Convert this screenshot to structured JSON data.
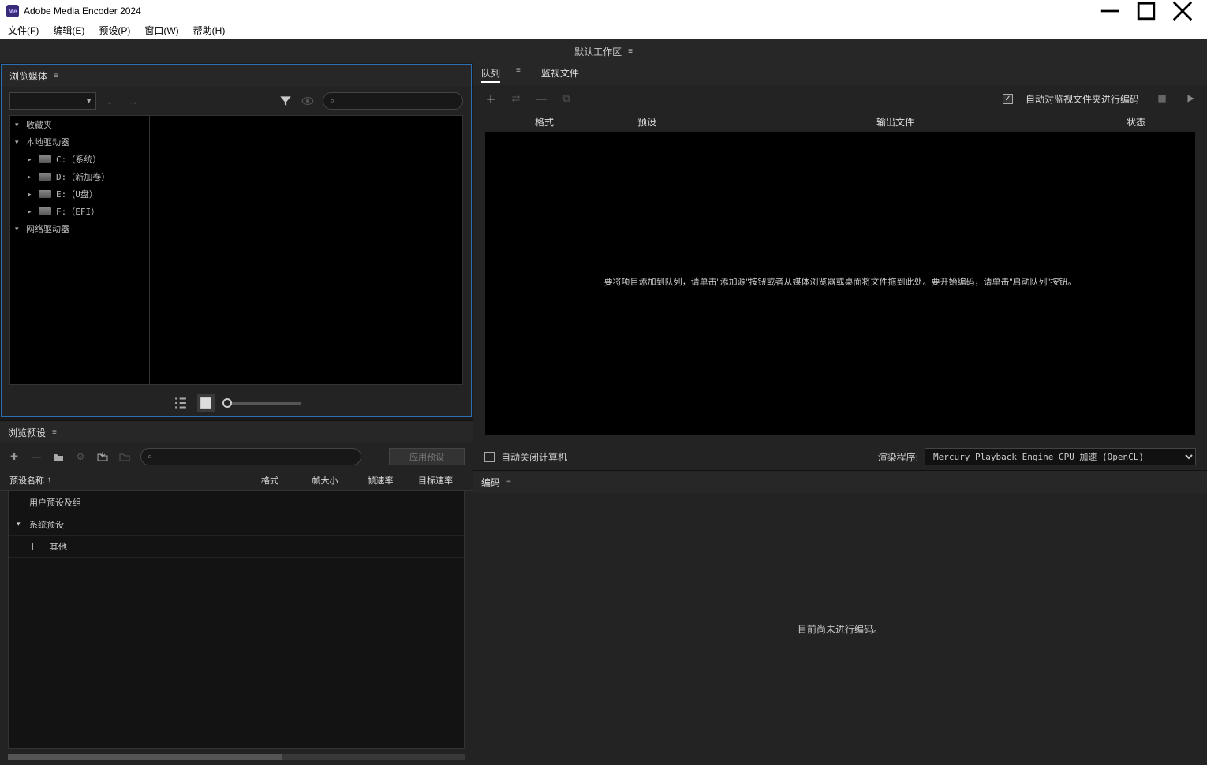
{
  "title": "Adobe Media Encoder 2024",
  "menu": [
    "文件(F)",
    "编辑(E)",
    "预设(P)",
    "窗口(W)",
    "帮助(H)"
  ],
  "workspace": "默认工作区",
  "browser": {
    "title": "浏览媒体",
    "searchPlaceholder": "",
    "tree": {
      "favorites": "收藏夹",
      "local": "本地驱动器",
      "drives": [
        "C:（系统）",
        "D:（新加卷）",
        "E:（U盘）",
        "F:（EFI）"
      ],
      "network": "网络驱动器"
    }
  },
  "presets": {
    "title": "浏览预设",
    "applyLabel": "应用预设",
    "headers": {
      "name": "预设名称",
      "format": "格式",
      "frameSize": "帧大小",
      "frameRate": "帧速率",
      "targetRate": "目标速率"
    },
    "rows": {
      "userGroups": "用户预设及组",
      "systemPresets": "系统预设",
      "other": "其他"
    }
  },
  "queue": {
    "tabs": {
      "queue": "队列",
      "watch": "监视文件"
    },
    "autoEncodeWatch": "自动对监视文件夹进行编码",
    "headers": {
      "format": "格式",
      "preset": "预设",
      "output": "输出文件",
      "status": "状态"
    },
    "emptyMsg": "要将项目添加到队列，请单击\"添加源\"按钮或者从媒体浏览器或桌面将文件拖到此处。要开始编码，请单击\"启动队列\"按钮。",
    "autoShutdown": "自动关闭计算机",
    "rendererLabel": "渲染程序:",
    "rendererValue": "Mercury Playback Engine GPU 加速 (OpenCL)"
  },
  "encode": {
    "title": "编码",
    "emptyMsg": "目前尚未进行编码。"
  }
}
